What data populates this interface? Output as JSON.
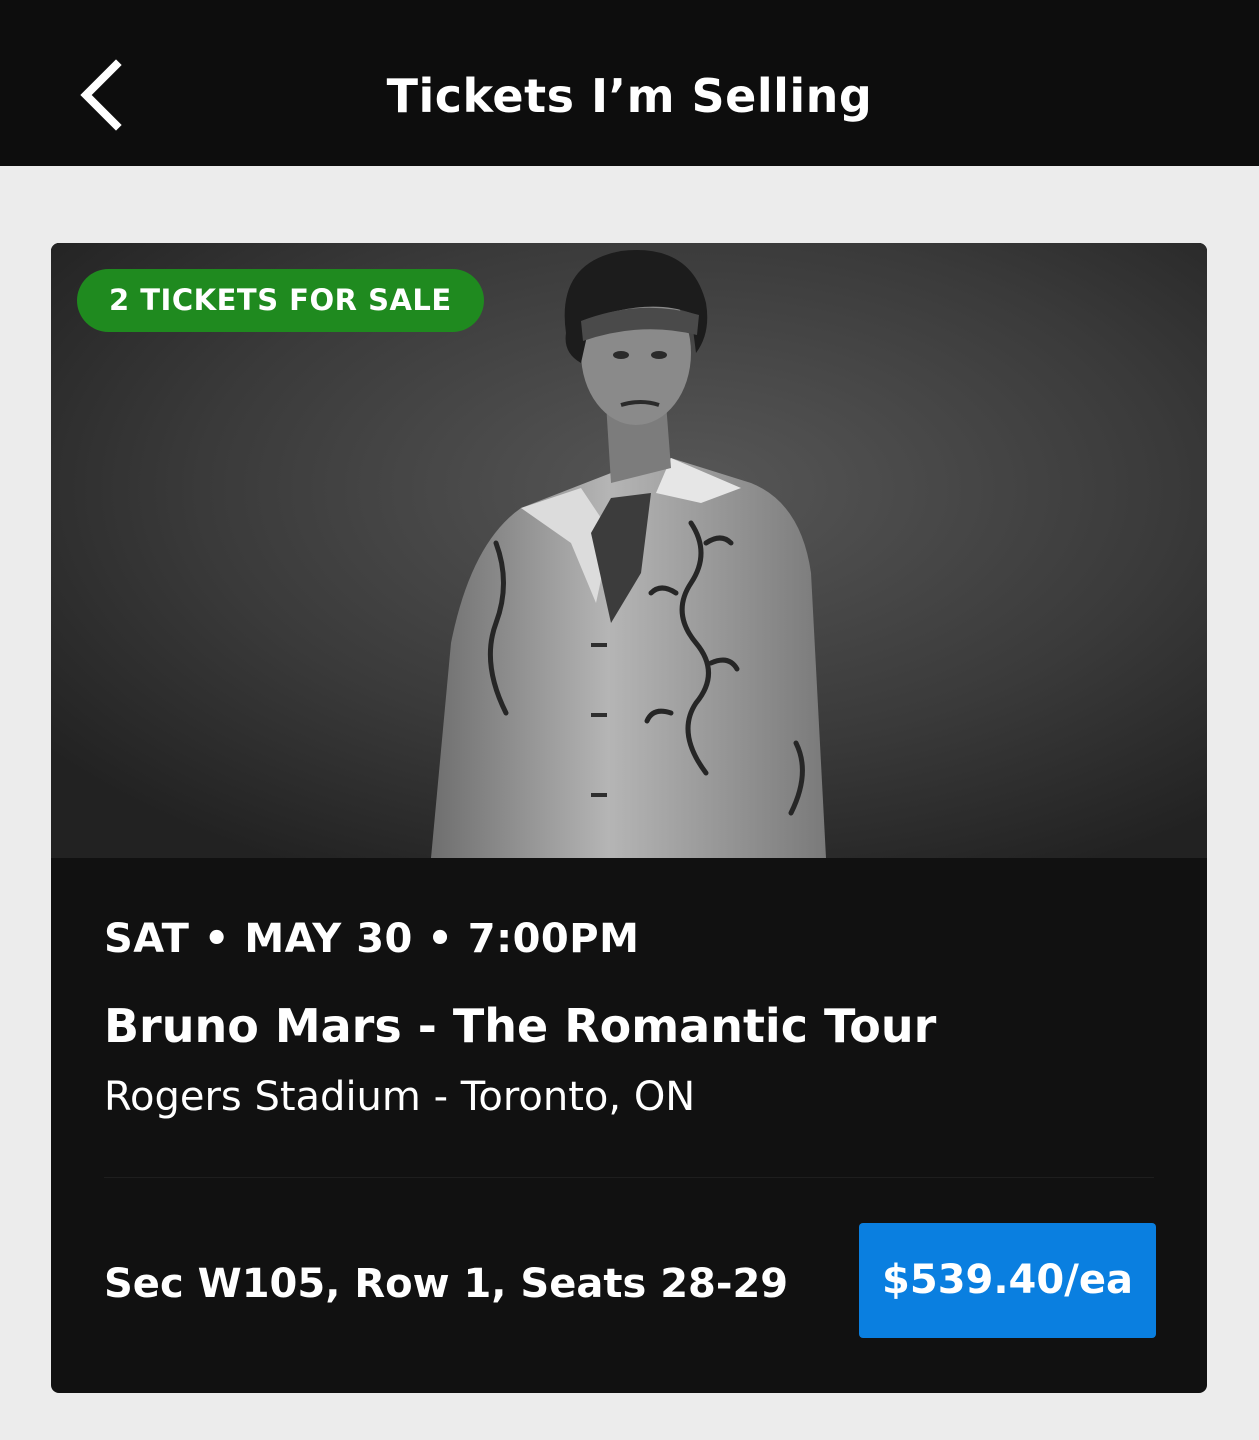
{
  "header": {
    "title": "Tickets I’m Selling",
    "back_icon": "chevron-left-icon"
  },
  "listing": {
    "badge": "2 TICKETS FOR SALE",
    "badge_color": "#1f8a1f",
    "date_line": "SAT • MAY 30 • 7:00PM",
    "event_name": "Bruno Mars - The Romantic Tour",
    "venue": "Rogers Stadium - Toronto, ON",
    "seats": "Sec W105, Row 1, Seats 28-29",
    "price": "$539.40/ea",
    "price_button_color": "#0a7fe0"
  },
  "colors": {
    "header_bg": "#0d0d0d",
    "page_bg": "#ececec",
    "card_bg": "#111111"
  }
}
